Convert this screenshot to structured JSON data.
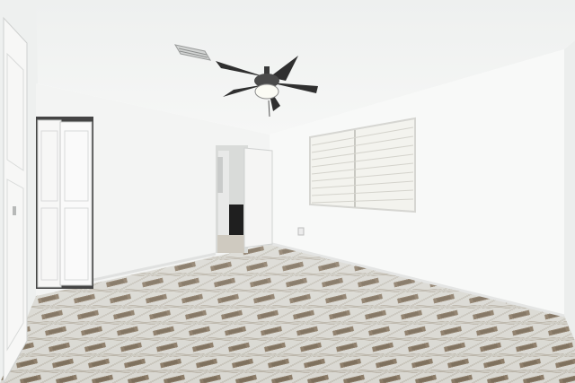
{
  "scene": {
    "subject": "empty-bedroom",
    "colors": {
      "ceiling": "#f2f3f2",
      "wall_front": "#f4f5f4",
      "wall_left": "#eceeed",
      "wall_right": "#f7f8f7",
      "tile_light": "#dcdcd6",
      "tile_inlay": "#8a7a66",
      "fan_metal": "#3a3a3a",
      "window_blind": "#f0f0ec"
    }
  }
}
